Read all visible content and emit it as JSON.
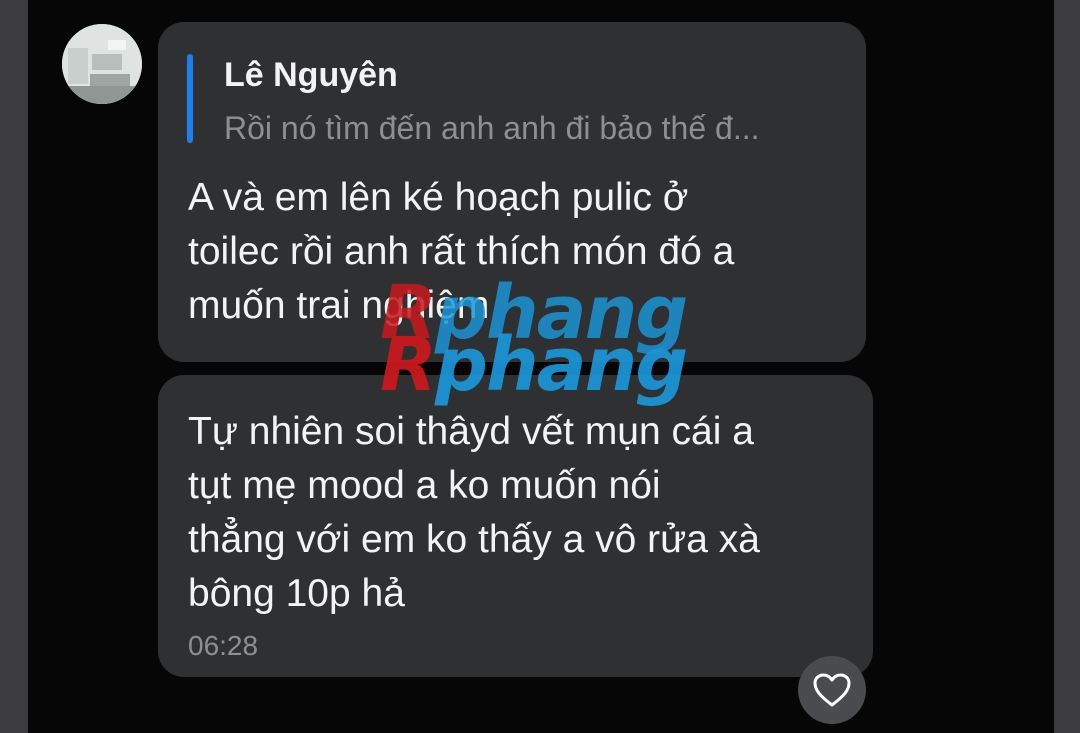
{
  "chat": {
    "messages": [
      {
        "reply_to": {
          "sender": "Lê Nguyên",
          "preview": "Rồi nó tìm đến anh anh đi bảo thế đ..."
        },
        "text": "A và em lên ké hoạch pulic ở\ntoilec rồi anh rất thích món đó a\nmuốn trai nghiệm"
      },
      {
        "text": "Tự nhiên soi thâyd vết mụn cái a\ntụt mẹ mood a ko muốn nói\nthẳng với em ko thấy a vô rửa xà\nbông 10p hả",
        "time": "06:28"
      }
    ],
    "reaction_icon": "heart-outline-icon"
  },
  "watermark": {
    "line1_part1": "R",
    "line1_part2": "phang",
    "line2_part1": "R",
    "line2_part2": "phang"
  },
  "colors": {
    "chat_background": "#060607",
    "side_panel": "#3c3c3f",
    "bubble": "#2f3032",
    "quote_bar": "#1f7ef2",
    "text": "#f3f3f3",
    "muted_text": "#8e8f93"
  }
}
